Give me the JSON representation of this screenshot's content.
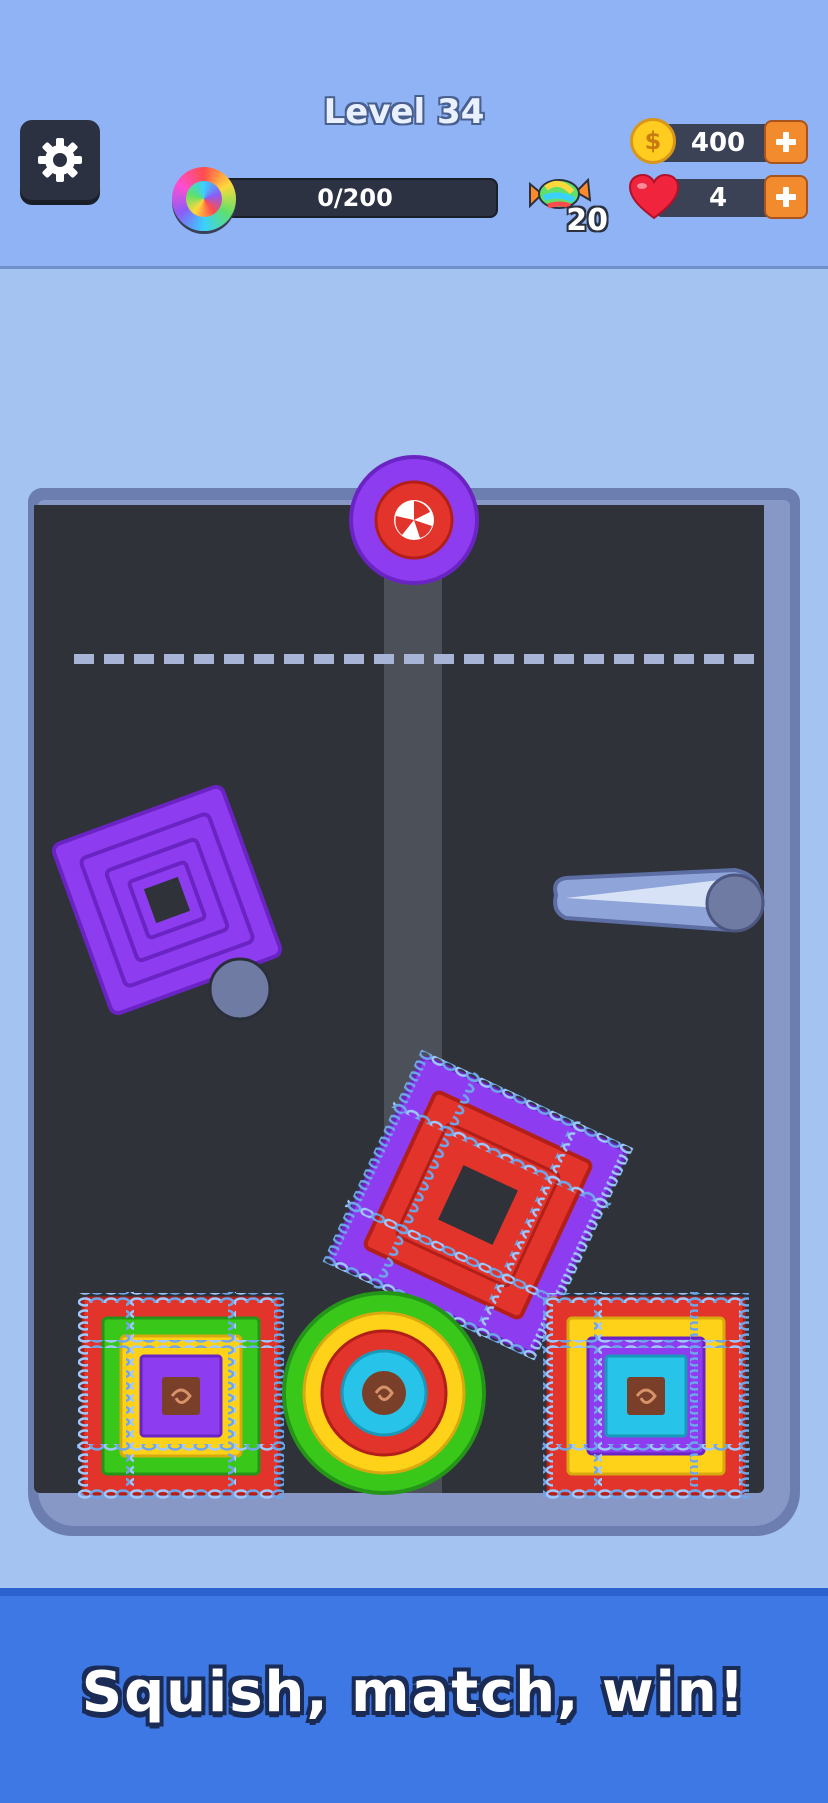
{
  "header": {
    "level_title": "Level 34",
    "progress": {
      "text": "0/200",
      "value": 0,
      "max": 200
    },
    "candy_count": "20",
    "coins": "400",
    "lives": "4",
    "plus_label": "+"
  },
  "footer": {
    "tagline": "Squish, match, win!"
  },
  "colors": {
    "purple": "#8e3cf0",
    "red": "#e2342b",
    "yellow": "#ffd21a",
    "green": "#39c81a",
    "cyan": "#27c3e8",
    "chain": "#9ec8ff",
    "board": "#2f3238"
  },
  "icons": [
    "gear-icon",
    "rainbow-ring-icon",
    "candy-icon",
    "coin-icon",
    "heart-icon",
    "plus-icon"
  ]
}
